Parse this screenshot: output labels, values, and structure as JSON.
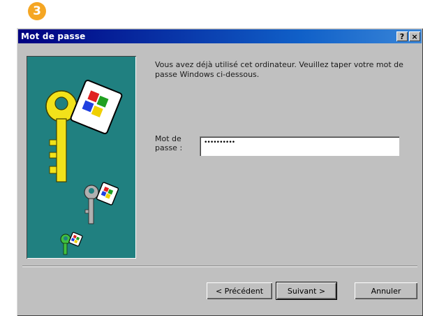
{
  "step": {
    "number": "3"
  },
  "window": {
    "title": "Mot de passe",
    "help_glyph": "?",
    "close_glyph": "×"
  },
  "content": {
    "prompt": "Vous avez déjà utilisé cet ordinateur. Veuillez taper votre mot de passe Windows ci-dessous.",
    "password_label": "Mot de passe :",
    "password_value": "••••••••••"
  },
  "buttons": {
    "back": "< Précédent",
    "next": "Suivant >",
    "cancel": "Annuler"
  },
  "illustration": {
    "icons": [
      "key-large-icon",
      "key-medium-icon",
      "key-small-icon",
      "windows-flag-icon"
    ]
  },
  "colors": {
    "title_bar": "#000080",
    "dialog_bg": "#c0c0c0",
    "art_bg": "#208080",
    "badge": "#f5a623"
  }
}
